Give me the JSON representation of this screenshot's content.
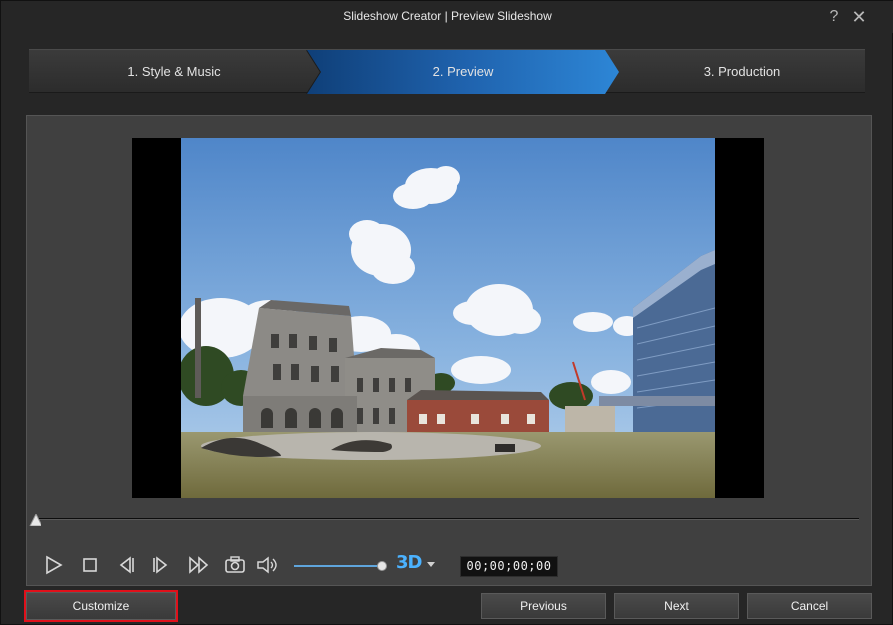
{
  "window": {
    "title": "Slideshow Creator | Preview Slideshow"
  },
  "titlebar": {
    "help_icon": "?",
    "close_icon": "✕"
  },
  "steps": [
    {
      "label": "1. Style & Music",
      "active": false
    },
    {
      "label": "2. Preview",
      "active": true
    },
    {
      "label": "3. Production",
      "active": false
    }
  ],
  "player": {
    "timecode": "00;00;00;00",
    "three_d_label": "3D",
    "seek_position": 0,
    "volume_level": 0.95,
    "controls": [
      "play-icon",
      "stop-icon",
      "previous-frame-icon",
      "next-frame-icon",
      "fast-forward-icon",
      "snapshot-camera-icon",
      "volume-icon"
    ]
  },
  "buttons": {
    "customize": "Customize",
    "previous": "Previous",
    "next": "Next",
    "cancel": "Cancel"
  },
  "colors": {
    "accent_blue": "#2a78c8",
    "highlight_red": "#e0101a",
    "three_d_blue": "#4bb2ff"
  }
}
